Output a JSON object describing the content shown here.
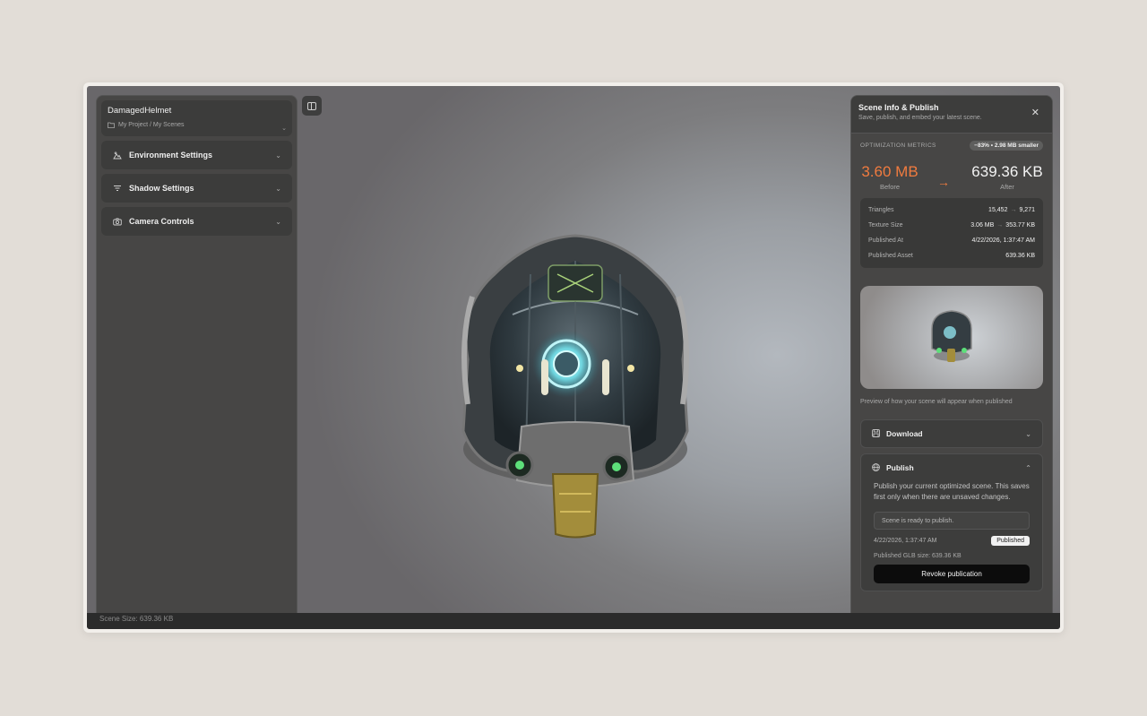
{
  "left_panel": {
    "project_title": "DamagedHelmet",
    "project_path": "My Project / My Scenes",
    "sections": [
      {
        "label": "Environment Settings",
        "icon": "environment-icon"
      },
      {
        "label": "Shadow Settings",
        "icon": "shadow-icon"
      },
      {
        "label": "Camera Controls",
        "icon": "camera-icon"
      }
    ]
  },
  "status_bar": {
    "text": "Scene Size: 639.36 KB"
  },
  "right_panel": {
    "title": "Scene Info & Publish",
    "subtitle": "Save, publish, and embed your latest scene.",
    "metrics_label": "OPTIMIZATION METRICS",
    "metrics_badge": "−83% • 2.98 MB smaller",
    "before_value": "3.60 MB",
    "before_label": "Before",
    "after_value": "639.36 KB",
    "after_label": "After",
    "stats": [
      {
        "key": "Triangles",
        "before": "15,452",
        "after": "9,271"
      },
      {
        "key": "Texture Size",
        "before": "3.06 MB",
        "after": "353.77 KB"
      },
      {
        "key": "Published At",
        "value": "4/22/2026, 1:37:47 AM"
      },
      {
        "key": "Published Asset",
        "value": "639.36 KB"
      }
    ],
    "preview_caption": "Preview of how your scene will appear when published",
    "download_label": "Download",
    "publish_label": "Publish",
    "publish_description": "Publish your current optimized scene. This saves first only when there are unsaved changes.",
    "publish_status": "Scene is ready to publish.",
    "publish_date": "4/22/2026, 1:37:47 AM",
    "publish_badge": "Published",
    "published_size": "Published GLB size: 639.36 KB",
    "revoke_label": "Revoke publication"
  },
  "colors": {
    "accent_orange": "#f07b3f",
    "panel_bg": "#474645",
    "button_dark": "#0c0c0c"
  }
}
